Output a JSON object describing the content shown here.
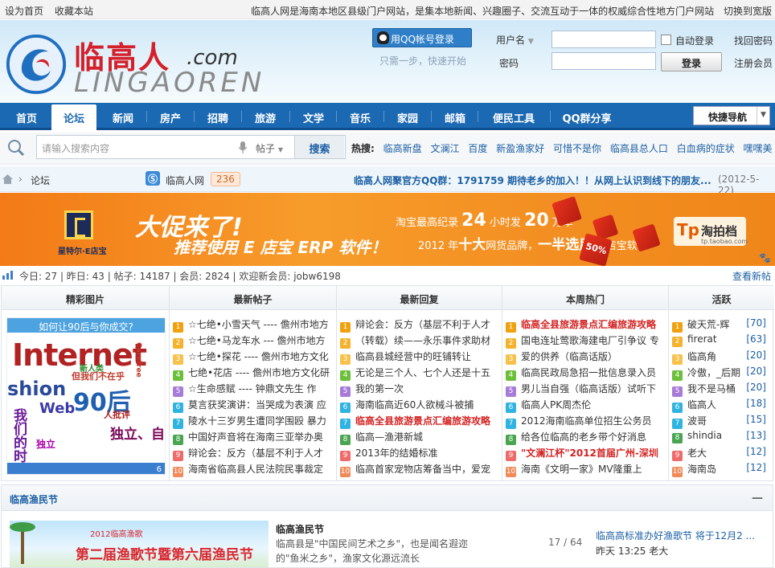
{
  "topbar": {
    "set_home": "设为首页",
    "bookmark": "收藏本站",
    "tagline": "临高人网是海南本地区县级门户网站，是集本地新闻、兴趣圈子、交流互动于一体的权威综合性地方门户网站",
    "switch_wide": "切换到宽版"
  },
  "header": {
    "logo_cn": "临高人",
    "logo_com": ".com",
    "logo_en": "LINGAOREN",
    "qq_login": "用QQ帐号登录",
    "qq_hint": "只需一步，快速开始",
    "username_label": "用户名",
    "password_label": "密码",
    "auto_login": "自动登录",
    "login_button": "登录",
    "forgot_password": "找回密码",
    "register": "注册会员"
  },
  "nav": {
    "items": [
      "首页",
      "论坛",
      "新闻",
      "房产",
      "招聘",
      "旅游",
      "文学",
      "音乐",
      "家园",
      "邮箱",
      "便民工具",
      "QQ群分享"
    ],
    "active_index": 1,
    "quick_nav": "快捷导航"
  },
  "search": {
    "placeholder": "请输入搜索内容",
    "type": "帖子",
    "button": "搜索",
    "hot_label": "热搜:",
    "hot_terms": [
      "临高新盘",
      "文澜江",
      "百度",
      "新盈渔家好",
      "可惜不是你",
      "临高县总人口",
      "白血病的症状",
      "嘿嘿美"
    ]
  },
  "breadcrumb": {
    "current": "论坛",
    "forum_name": "临高人网",
    "forum_count": "236",
    "notice": "临高人网聚官方QQ群：1791759   期待老乡的加入！！从网上认识到线下的朋友...",
    "notice_date": "(2012-5-22)"
  },
  "banner": {
    "logo_text": "星特尔·E店宝",
    "headline": "大促来了!",
    "subline": "推荐使用 E 店宝 ERP 软件！",
    "line1_pre": "淘宝最高纪录",
    "line1_num1": "24",
    "line1_mid": "小时发",
    "line1_num2": "20",
    "line1_end": "万单",
    "line2_pre": "2012 年",
    "line2_big": "十大",
    "line2_mid": "网货品牌，",
    "line2_big2": "一半选用",
    "line2_end": "E 店宝软件",
    "cube_text": "50%",
    "partner_name": "淘拍档",
    "partner_logo": "Tp",
    "partner_url": "tp.taobao.com"
  },
  "stats": {
    "text": "今日: 27  |  昨日: 43  |  帖子: 14187  |  会员: 2824  |  欢迎新会员: jobw6198",
    "latest": "查看新帖"
  },
  "columns": {
    "pics": {
      "title": "精彩图片",
      "caption": "如何让90后与你成交?",
      "page_num": "6",
      "words": [
        "Internet",
        "shion",
        "Web",
        "90后",
        "我们的时代",
        "独立、自",
        "但我们不在乎",
        "Carefree",
        "人批评",
        "新人类",
        "独立"
      ]
    },
    "latest_posts": {
      "title": "最新帖子",
      "items": [
        "☆七绝•小雪天气 ---- 儋州市地方",
        "☆七绝•马龙车水 --- 儋州市地方",
        "☆七绝•探花 ---- 儋州市地方文化",
        "七绝•花店 ---- 儋州市地方文化研",
        "☆生命感赋 ---- 钟鼎文先生 作",
        "莫言获奖演讲：当哭成为表演 应",
        "陵水十三岁男生遭同学围殴 暴力",
        "中国好声音将在海南三亚举办奥",
        "辩论会：反方（基层不利于人才",
        "海南省临高县人民法院民事裁定"
      ]
    },
    "latest_replies": {
      "title": "最新回复",
      "items": [
        "辩论会：反方（基层不利于人才",
        "（转载）续——永乐事件求助材",
        "临高县城经营中的旺铺转让",
        "无论是三个人、七个人还是十五",
        "我的第一次",
        "海南临高近60人欲械斗被捕",
        "临高全县旅游景点汇编旅游攻略",
        "临高—渔港新城",
        "2013年的结婚标准",
        "临高首家宠物店筹备当中，爱宠"
      ]
    },
    "weekly_hot": {
      "title": "本周热门",
      "items": [
        "临高全县旅游景点汇编旅游攻略",
        "国电连址莺歌海建电厂引争议 专",
        "爱的供养（临高话版）",
        "临高民政局急招一批信息录入员",
        "男儿当自强（临高话版）试听下",
        "临高人PK周杰伦",
        "2012海南临高单位招生公务员",
        "给各位临高的老乡带个好消息",
        "\"文澜江杯\"2012首届广州-深圳",
        "海南《文明一家》MV隆重上"
      ]
    },
    "active": {
      "title": "活跃",
      "items": [
        {
          "name": "破天荒-辉",
          "count": "[70]"
        },
        {
          "name": "firerat",
          "count": "[63]"
        },
        {
          "name": "临高角",
          "count": "[20]"
        },
        {
          "name": "冷傲，_后期",
          "count": "[20]"
        },
        {
          "name": "我不是马桶",
          "count": "[20]"
        },
        {
          "name": "临高人",
          "count": "[18]"
        },
        {
          "name": "波哥",
          "count": "[15]"
        },
        {
          "name": "shindia",
          "count": "[13]"
        },
        {
          "name": "老大",
          "count": "[12]"
        },
        {
          "name": "海南岛",
          "count": "[12]"
        }
      ]
    }
  },
  "section": {
    "title": "临高渔民节",
    "collapse": "—",
    "image_title": "第二届渔歌节暨第六届渔民节",
    "image_sub": "2012临高渔歌",
    "forum_name": "临高渔民节",
    "description": "临高县是\"中国民间艺术之乡\"，也是闻名遐迩的\"鱼米之乡\"，渔家文化源远流长",
    "count": "17 / 64",
    "last_post": "临高高标准办好渔歌节 将于12月2 ...",
    "last_time": "昨天 13:25 老大"
  },
  "colors": {
    "nav_blue": "#1b68b3",
    "link_blue": "#1b5fa3",
    "banner_orange": "#f38f22",
    "hot_red": "#d42222"
  }
}
